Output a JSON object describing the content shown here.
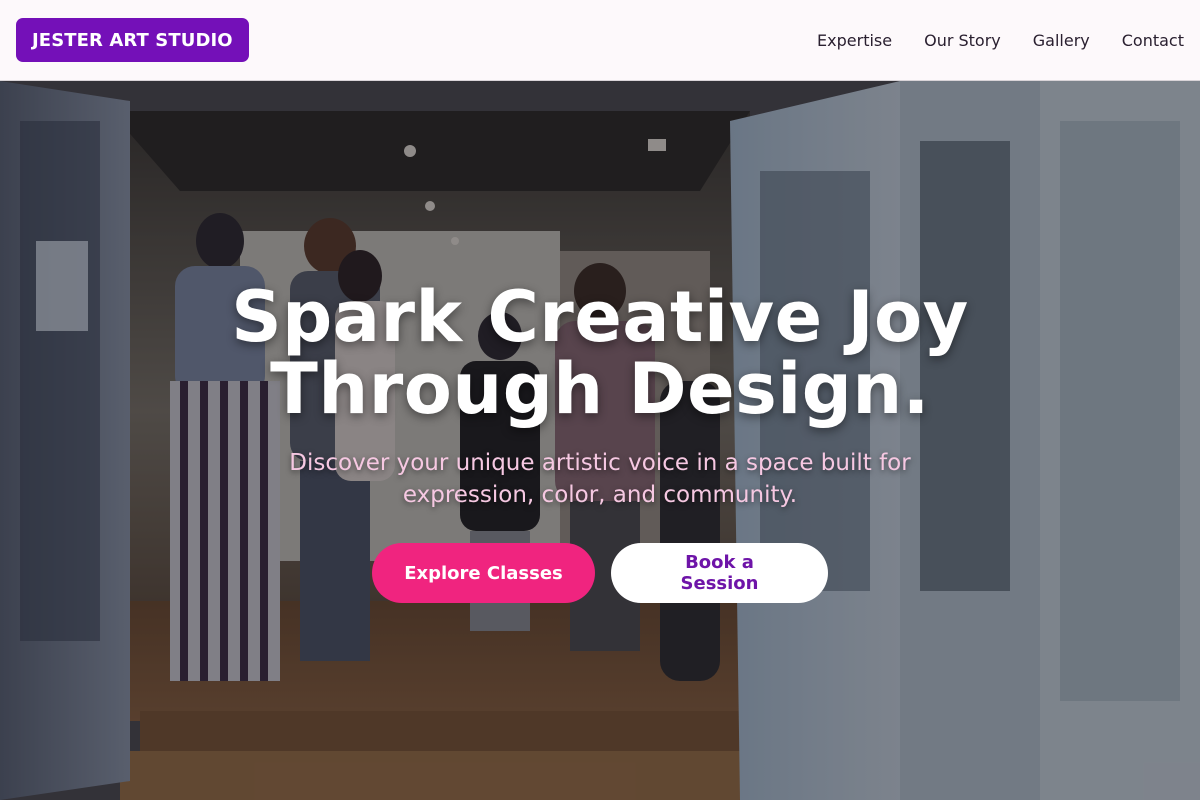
{
  "brand": {
    "name": "JESTER ART STUDIO"
  },
  "nav": {
    "items": [
      {
        "label": "Expertise"
      },
      {
        "label": "Our Story"
      },
      {
        "label": "Gallery"
      },
      {
        "label": "Contact"
      }
    ]
  },
  "hero": {
    "title_line1": "Spark Creative Joy",
    "title_line2": "Through Design.",
    "subtitle": "Discover your unique artistic voice in a space built for expression, color, and community.",
    "primary_button": "Explore Classes",
    "secondary_button": "Book a Session",
    "image": "art-studio-gallery-photo"
  },
  "colors": {
    "brand_purple": "#7410b8",
    "primary_pink": "#f0247f",
    "secondary_text_purple": "#6e14a8",
    "subtitle_pink": "#f6c8e2"
  }
}
